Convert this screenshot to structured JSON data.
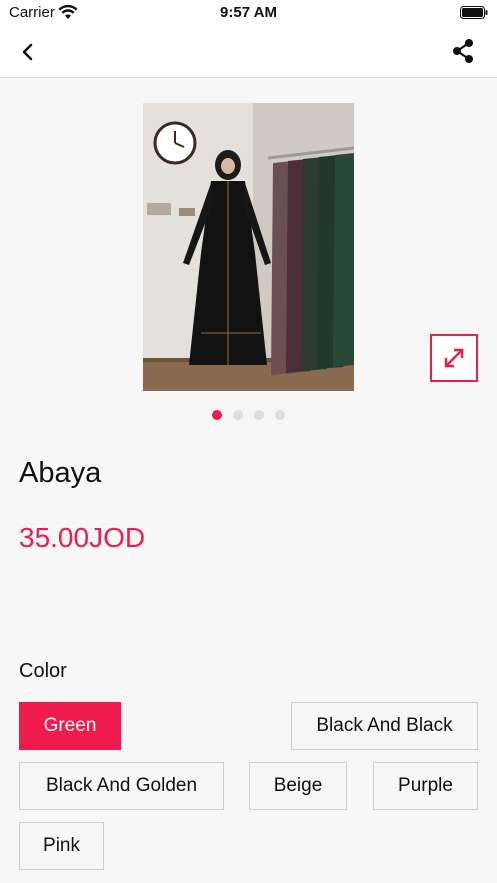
{
  "status_bar": {
    "carrier": "Carrier",
    "time": "9:57 AM"
  },
  "nav": {
    "back_icon": "chevron-left-icon",
    "share_icon": "share-icon"
  },
  "product": {
    "image_description": "woman wearing black abaya in shop",
    "title": "Abaya",
    "price": "35.00JOD",
    "gallery_current_index": 1,
    "gallery_total": 4,
    "expand_icon": "expand-arrows-icon"
  },
  "color": {
    "label": "Color",
    "options": [
      {
        "label": "Green",
        "selected": true
      },
      {
        "label": "Black And Black",
        "selected": false
      },
      {
        "label": "Black And Golden",
        "selected": false
      },
      {
        "label": "Beige",
        "selected": false
      },
      {
        "label": "Purple",
        "selected": false
      },
      {
        "label": "Pink",
        "selected": false
      }
    ]
  },
  "colors": {
    "accent": "#ee1d4d",
    "background": "#f7f7f7"
  }
}
